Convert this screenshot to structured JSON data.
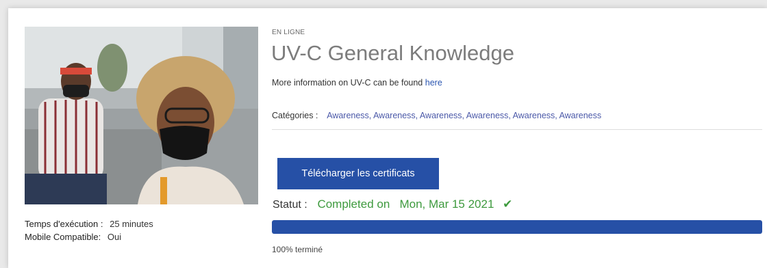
{
  "course": {
    "mode": "EN LIGNE",
    "title": "UV-C General Knowledge",
    "info_text": "More information on UV-C can be found",
    "info_link": "here",
    "categories_label": "Catégories :",
    "categories": "Awareness, Awareness, Awareness, Awareness, Awareness, Awareness"
  },
  "meta": {
    "duration_label": "Temps d'exécution :",
    "duration_value": "25 minutes",
    "mobile_label": "Mobile Compatible:",
    "mobile_value": "Oui"
  },
  "actions": {
    "download_label": "Télécharger les certificats"
  },
  "status": {
    "label": "Statut :",
    "value": "Completed on   Mon, Mar 15 2021",
    "icon": "checkmark-icon",
    "color": "#3e9a3e"
  },
  "progress": {
    "percent": 100,
    "text": "100% terminé",
    "color": "#2650a6"
  },
  "image": {
    "description_icon": "course-photo"
  }
}
